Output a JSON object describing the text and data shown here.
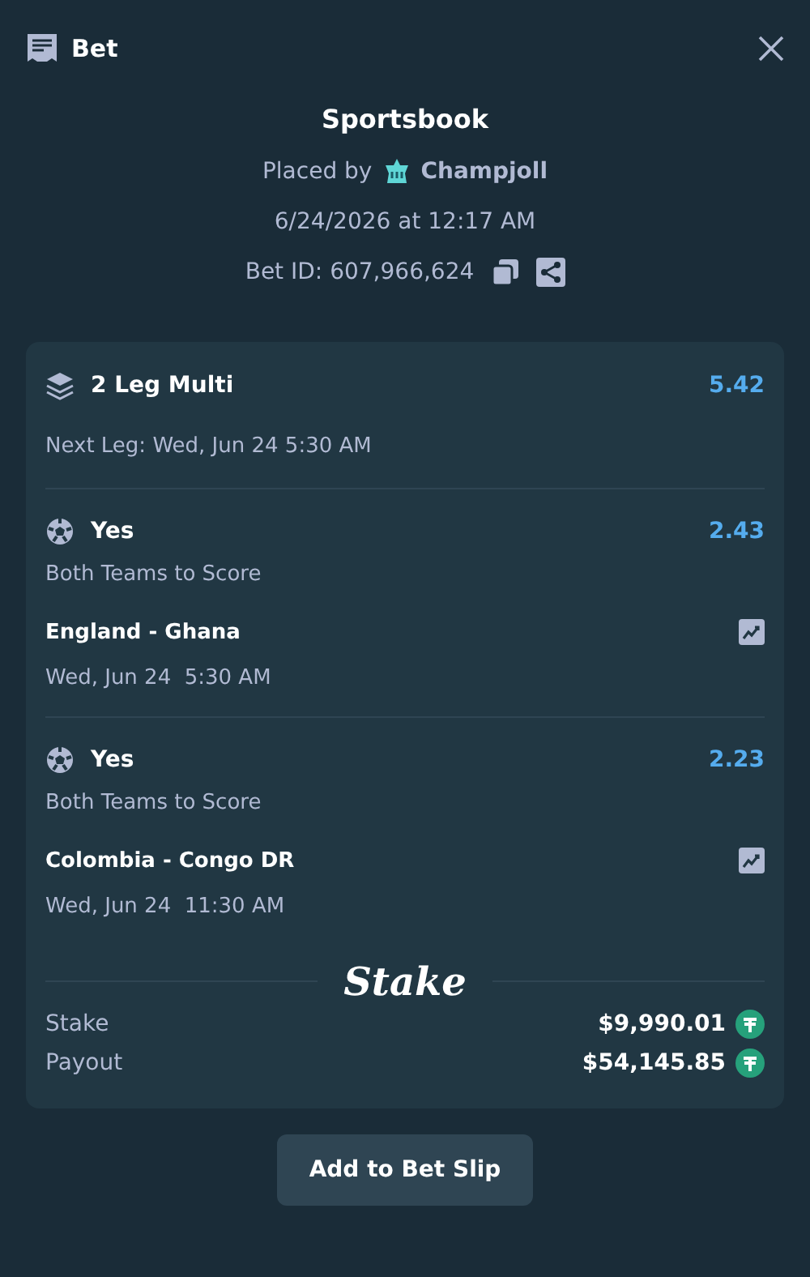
{
  "header": {
    "title": "Bet"
  },
  "summary": {
    "title": "Sportsbook",
    "placed_by_label": "Placed by",
    "user": "Champjoll",
    "date": "6/24/2026 at 12:17 AM",
    "bet_id": "Bet ID: 607,966,624"
  },
  "multi": {
    "title": "2 Leg Multi",
    "odds": "5.42",
    "next_leg": "Next Leg: Wed, Jun 24 5:30 AM"
  },
  "legs": [
    {
      "selection": "Yes",
      "odds": "2.43",
      "market": "Both Teams to Score",
      "match": "England - Ghana",
      "time": "Wed, Jun 24  5:30 AM"
    },
    {
      "selection": "Yes",
      "odds": "2.23",
      "market": "Both Teams to Score",
      "match": "Colombia - Congo DR",
      "time": "Wed, Jun 24  11:30 AM"
    }
  ],
  "logo": "Stake",
  "totals": [
    {
      "label": "Stake",
      "amount": "$9,990.01"
    },
    {
      "label": "Payout",
      "amount": "$54,145.85"
    }
  ],
  "button": "Add to Bet Slip"
}
